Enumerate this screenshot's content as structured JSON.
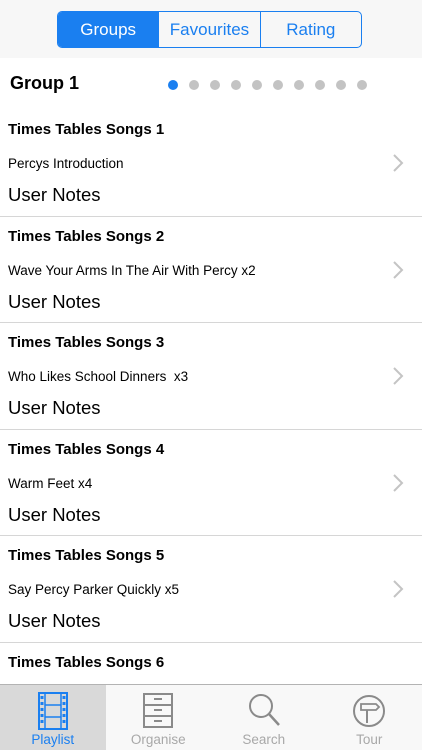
{
  "segments": [
    {
      "label": "Groups",
      "active": true
    },
    {
      "label": "Favourites",
      "active": false
    },
    {
      "label": "Rating",
      "active": false
    }
  ],
  "group": {
    "title": "Group 1",
    "page_count": 10,
    "current_page": 1
  },
  "items": [
    {
      "title": "Times Tables Songs 1",
      "subtitle": "Percys Introduction",
      "notes": "User Notes"
    },
    {
      "title": "Times Tables Songs 2",
      "subtitle": "Wave Your Arms In The Air With Percy x2",
      "notes": "User Notes"
    },
    {
      "title": "Times Tables Songs 3",
      "subtitle": "Who Likes School Dinners  x3",
      "notes": "User Notes"
    },
    {
      "title": "Times Tables Songs 4",
      "subtitle": "Warm Feet x4",
      "notes": "User Notes"
    },
    {
      "title": "Times Tables Songs 5",
      "subtitle": "Say Percy Parker Quickly x5",
      "notes": "User Notes"
    },
    {
      "title": "Times Tables Songs 6",
      "subtitle": "",
      "notes": ""
    }
  ],
  "tabs": [
    {
      "label": "Playlist",
      "icon": "film-strip-icon",
      "active": true
    },
    {
      "label": "Organise",
      "icon": "cabinet-icon",
      "active": false
    },
    {
      "label": "Search",
      "icon": "magnifier-icon",
      "active": false
    },
    {
      "label": "Tour",
      "icon": "signpost-icon",
      "active": false
    }
  ],
  "colors": {
    "accent": "#1a7ff0",
    "inactive": "#a8a8a8",
    "separator": "#d6d6d6"
  }
}
